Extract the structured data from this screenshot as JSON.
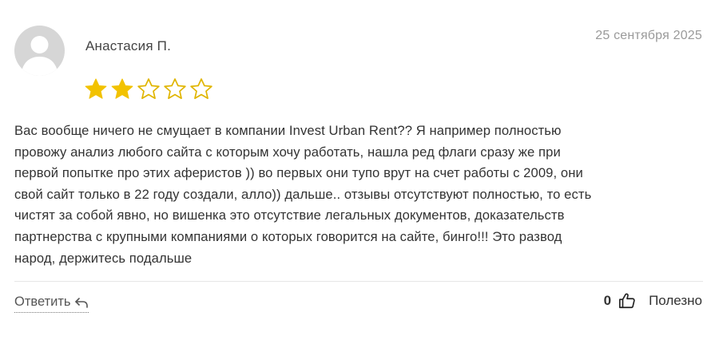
{
  "review": {
    "author": "Анастасия П.",
    "date": "25 сентября 2025",
    "rating": 2,
    "max_rating": 5,
    "text_lines": [
      "Вас вообще ничего не смущает в компании Invest Urban Rent?? Я например полностью",
      "провожу анализ любого сайта с которым хочу работать, нашла ред флаги сразу же при",
      "первой попытке про этих аферистов )) во первых они тупо врут на счет работы с 2009, они",
      "свой сайт только в 22 году создали, алло)) дальше.. отзывы отсутствуют полностью, то есть",
      "чистят за собой явно, но вишенка это отсутствие легальных документов, доказательств",
      "партнерства с крупными компаниями о которых говорится на сайте, бинго!!! Это развод",
      "народ, держитесь подальше"
    ]
  },
  "actions": {
    "reply_label": "Ответить",
    "reply_icon": "reply-arrow-icon",
    "vote_count": "0",
    "thumb_icon": "thumbs-up-icon",
    "helpful_label": "Полезно"
  },
  "colors": {
    "star_filled": "#f2c200",
    "star_empty_stroke": "#e0b500",
    "avatar_bg": "#d6d6d6",
    "avatar_fg": "#ffffff",
    "date_text": "#9a9a9a",
    "divider": "#e6e6e6"
  }
}
